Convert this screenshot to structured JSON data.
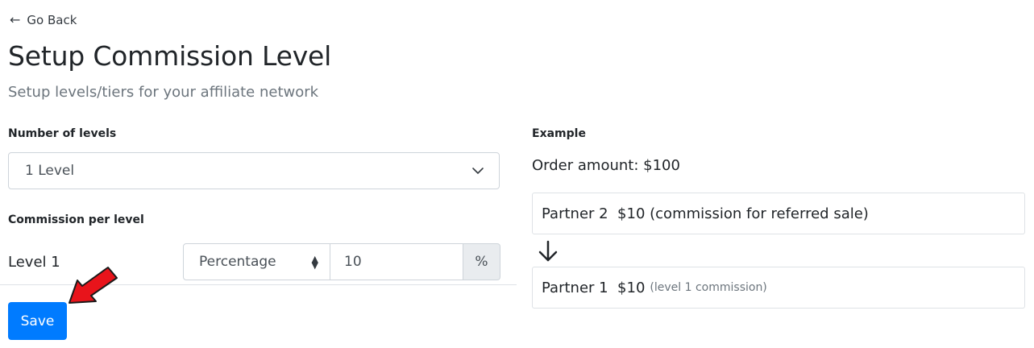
{
  "nav": {
    "back_label": "Go Back",
    "back_icon": "arrow-left-icon"
  },
  "header": {
    "title": "Setup Commission Level",
    "subtitle": "Setup levels/tiers for your affiliate network"
  },
  "form": {
    "levels_label": "Number of levels",
    "levels_value": "1 Level",
    "commission_label": "Commission per level",
    "levels": [
      {
        "label": "Level 1",
        "type": "Percentage",
        "amount": "10",
        "unit": "%"
      }
    ],
    "save_label": "Save"
  },
  "example": {
    "heading": "Example",
    "order_amount": "Order amount: $100",
    "cards": [
      {
        "partner": "Partner 2",
        "amount": "$10",
        "note": "(commission for referred sale)"
      },
      {
        "partner": "Partner 1",
        "amount": "$10",
        "note": "(level 1 commission)"
      }
    ]
  },
  "colors": {
    "primary": "#007bff",
    "annotation_arrow": "#e8141b"
  }
}
